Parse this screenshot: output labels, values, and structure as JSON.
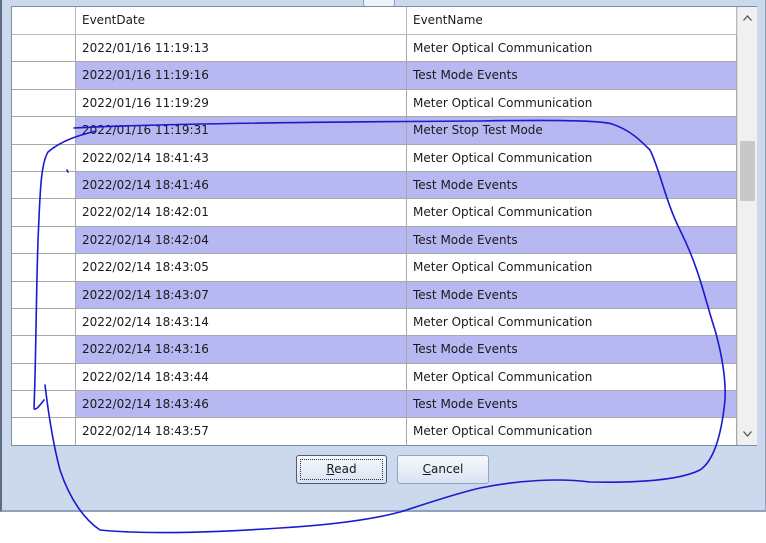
{
  "grid": {
    "columns": [
      "EventDate",
      "EventName"
    ],
    "rows": [
      {
        "date": "2022/01/16 11:19:13",
        "name": "Meter Optical Communication",
        "highlight": false
      },
      {
        "date": "2022/01/16 11:19:16",
        "name": "Test Mode Events",
        "highlight": true
      },
      {
        "date": "2022/01/16 11:19:29",
        "name": "Meter Optical Communication",
        "highlight": false
      },
      {
        "date": "2022/01/16 11:19:31",
        "name": "Meter Stop Test Mode",
        "highlight": true
      },
      {
        "date": "2022/02/14 18:41:43",
        "name": "Meter Optical Communication",
        "highlight": false
      },
      {
        "date": "2022/02/14 18:41:46",
        "name": "Test Mode Events",
        "highlight": true
      },
      {
        "date": "2022/02/14 18:42:01",
        "name": "Meter Optical Communication",
        "highlight": false
      },
      {
        "date": "2022/02/14 18:42:04",
        "name": "Test Mode Events",
        "highlight": true
      },
      {
        "date": "2022/02/14 18:43:05",
        "name": "Meter Optical Communication",
        "highlight": false
      },
      {
        "date": "2022/02/14 18:43:07",
        "name": "Test Mode Events",
        "highlight": true
      },
      {
        "date": "2022/02/14 18:43:14",
        "name": "Meter Optical Communication",
        "highlight": false
      },
      {
        "date": "2022/02/14 18:43:16",
        "name": "Test Mode Events",
        "highlight": true
      },
      {
        "date": "2022/02/14 18:43:44",
        "name": "Meter Optical Communication",
        "highlight": false
      },
      {
        "date": "2022/02/14 18:43:46",
        "name": "Test Mode Events",
        "highlight": true
      },
      {
        "date": "2022/02/14 18:43:57",
        "name": "Meter Optical Communication",
        "highlight": false
      }
    ]
  },
  "scrollbar": {
    "up_icon": "chevron-up-icon",
    "down_icon": "chevron-down-icon"
  },
  "buttons": {
    "read": {
      "mnemonic": "R",
      "rest": "ead"
    },
    "cancel": {
      "mnemonic": "C",
      "rest": "ancel"
    }
  },
  "colors": {
    "alt_row": "#b7b7f2",
    "window_bg": "#ccd9ec",
    "annotation_ink": "#1a1ad0"
  }
}
